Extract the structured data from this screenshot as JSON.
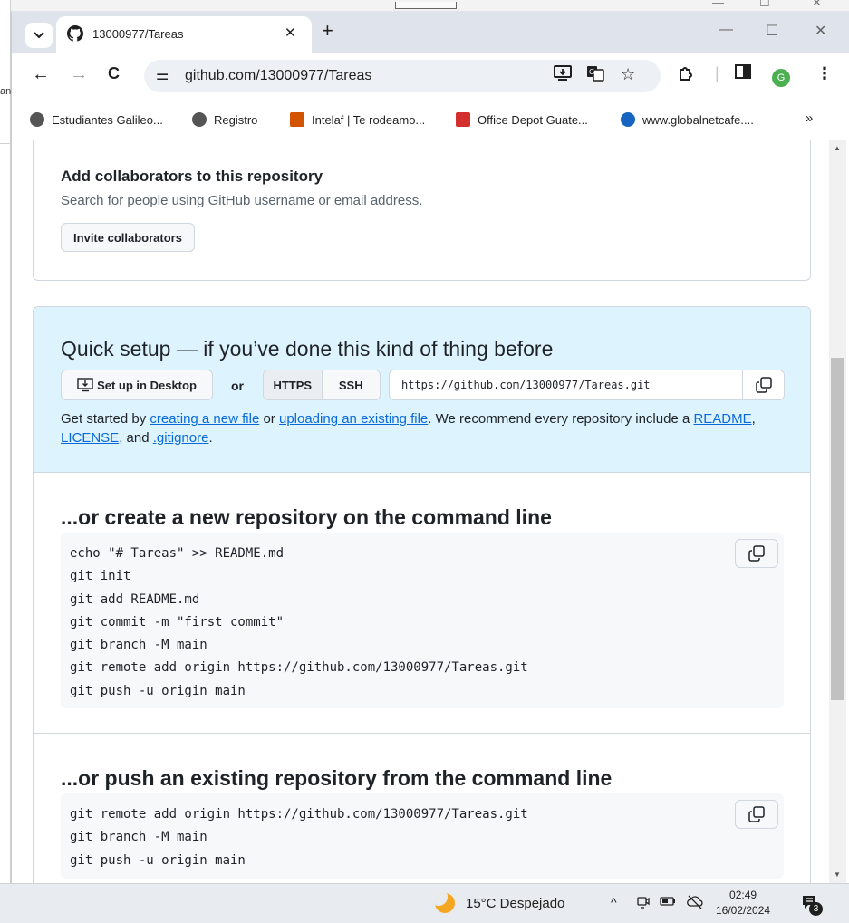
{
  "background_window": {
    "left_strip_text": "ana"
  },
  "tab": {
    "title": "13000977/Tareas",
    "close": "✕"
  },
  "newtab": "+",
  "window_controls": {
    "minimize": "—",
    "maximize": "☐",
    "close": "✕"
  },
  "toolbar": {
    "url": "github.com/13000977/Tareas",
    "back": "←",
    "forward": "→",
    "reload": "C"
  },
  "bookmarks": [
    {
      "label": "Estudiantes Galileo...",
      "color": "#444444"
    },
    {
      "label": "Registro",
      "color": "#444444"
    },
    {
      "label": "Intelaf | Te rodeamo...",
      "color": "#d35400"
    },
    {
      "label": "Office Depot Guate...",
      "color": "#d32f2f"
    },
    {
      "label": "www.globalnetcafe....",
      "color": "#1565c0"
    }
  ],
  "bookmarks_more": "»",
  "profile_initial": "G",
  "collaborators": {
    "title": "Add collaborators to this repository",
    "subtitle": "Search for people using GitHub username or email address.",
    "button": "Invite collaborators"
  },
  "quick_setup": {
    "title": "Quick setup — if you’ve done this kind of thing before",
    "desktop_button": "Set up in Desktop",
    "or": "or",
    "https": "HTTPS",
    "ssh": "SSH",
    "clone_url": "https://github.com/13000977/Tareas.git",
    "desc_1": "Get started by ",
    "link_new_file": "creating a new file",
    "desc_2": " or ",
    "link_upload": "uploading an existing file",
    "desc_3": ". We recommend every repository include a ",
    "link_readme": "README",
    "desc_4": ", ",
    "link_license": "LICENSE",
    "desc_5": ", and ",
    "link_gitignore": ".gitignore",
    "desc_6": "."
  },
  "new_repo": {
    "title": "...or create a new repository on the command line",
    "lines": [
      "echo \"# Tareas\" >> README.md",
      "git init",
      "git add README.md",
      "git commit -m \"first commit\"",
      "git branch -M main",
      "git remote add origin https://github.com/13000977/Tareas.git",
      "git push -u origin main"
    ]
  },
  "push_repo": {
    "title": "...or push an existing repository from the command line",
    "lines": [
      "git remote add origin https://github.com/13000977/Tareas.git",
      "git branch -M main",
      "git push -u origin main"
    ]
  },
  "taskbar": {
    "weather": "15°C  Despejado",
    "time": "02:49",
    "date": "16/02/2024",
    "notifications": "3"
  },
  "colors": {
    "accent_link": "#0969da",
    "setup_bg": "#ddf4ff",
    "border": "#d0d7de"
  }
}
